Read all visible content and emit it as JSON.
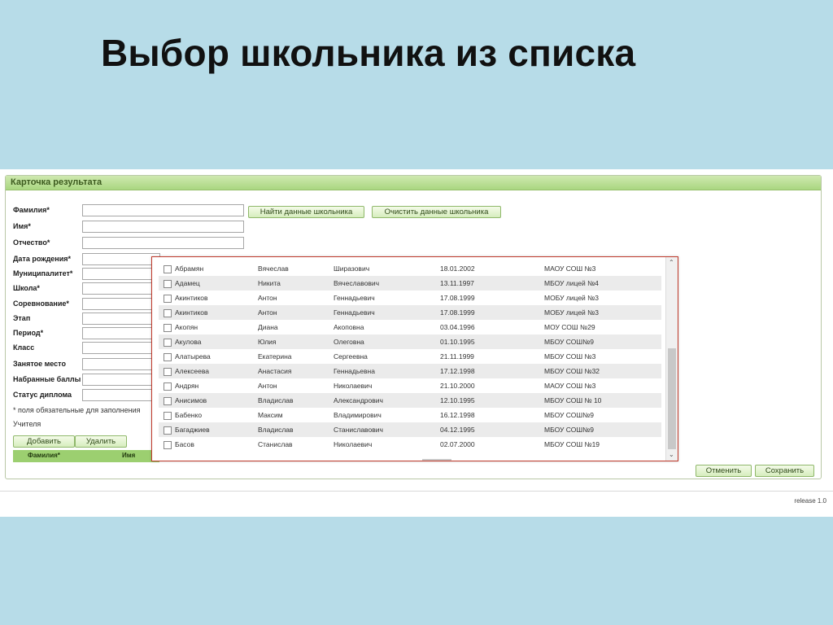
{
  "slide": {
    "title": "Выбор школьника из списка"
  },
  "card": {
    "header": "Карточка результата",
    "fields": [
      "Фамилия*",
      "Имя*",
      "Отчество*",
      "Дата рождения*",
      "Муниципалитет*",
      "Школа*",
      "Соревнование*",
      "Этап",
      "Период*",
      "Класс",
      "Занятое место",
      "Набранные баллы",
      "Статус диплома"
    ],
    "find_button": "Найти данные школьника",
    "clear_button": "Очистить данные школьника",
    "required_note": "* поля обязательные для заполнения",
    "teachers_label": "Учителя",
    "add_button": "Добавить",
    "delete_button": "Удалить",
    "grid_columns": [
      "Фамилия*",
      "Имя"
    ],
    "cancel_button": "Отменить",
    "save_button": "Сохранить"
  },
  "popup": {
    "rows": [
      [
        "Абрамян",
        "Вячеслав",
        "Ширазович",
        "18.01.2002",
        "МАОУ СОШ №3"
      ],
      [
        "Адамец",
        "Никита",
        "Вячеславович",
        "13.11.1997",
        "МБОУ лицей №4"
      ],
      [
        "Акинтиков",
        "Антон",
        "Геннадьевич",
        "17.08.1999",
        "МОБУ лицей №3"
      ],
      [
        "Акинтиков",
        "Антон",
        "Геннадьевич",
        "17.08.1999",
        "МОБУ лицей №3"
      ],
      [
        "Акопян",
        "Диана",
        "Акоповна",
        "03.04.1996",
        "МОУ СОШ №29"
      ],
      [
        "Акулова",
        "Юлия",
        "Олеговна",
        "01.10.1995",
        "МБОУ СОШ№9"
      ],
      [
        "Алатырева",
        "Екатерина",
        "Сергеевна",
        "21.11.1999",
        "МБОУ СОШ №3"
      ],
      [
        "Алексеева",
        "Анастасия",
        "Геннадьевна",
        "17.12.1998",
        "МБОУ СОШ №32"
      ],
      [
        "Андрян",
        "Антон",
        "Николаевич",
        "21.10.2000",
        "МАОУ СОШ №3"
      ],
      [
        "Анисимов",
        "Владислав",
        "Александрович",
        "12.10.1995",
        "МБОУ СОШ № 10"
      ],
      [
        "Бабенко",
        "Максим",
        "Владимирович",
        "16.12.1998",
        "МБОУ СОШ№9"
      ],
      [
        "Багаджиев",
        "Владислав",
        "Станиславович",
        "04.12.1995",
        "МБОУ СОШ№9"
      ],
      [
        "Басов",
        "Станислав",
        "Николаевич",
        "02.07.2000",
        "МБОУ СОШ №19"
      ]
    ]
  },
  "footer": {
    "release": "release 1.0"
  }
}
